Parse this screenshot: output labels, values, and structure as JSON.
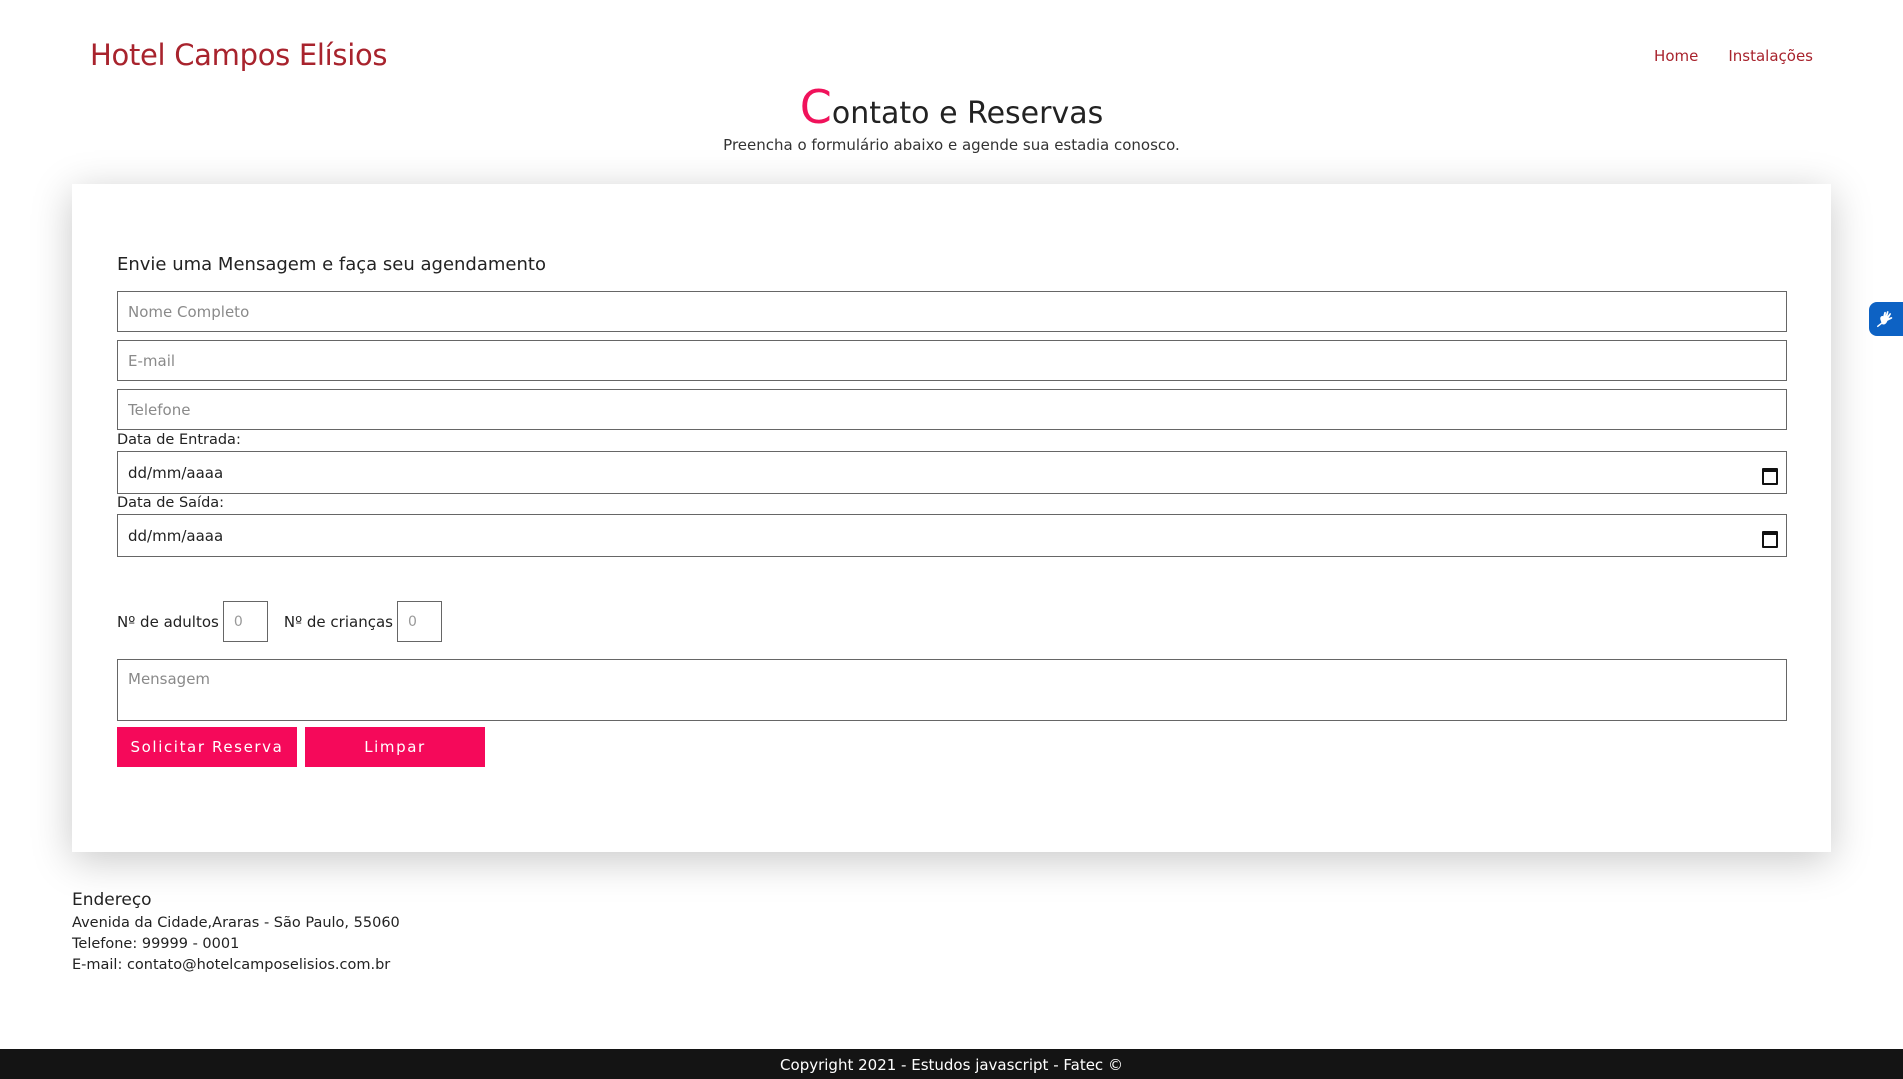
{
  "header": {
    "brand": "Hotel Campos Elísios",
    "nav": [
      {
        "label": "Home"
      },
      {
        "label": "Instalações"
      }
    ]
  },
  "page": {
    "title_initial": "C",
    "title_rest": "ontato e Reservas",
    "subtitle": "Preencha o formulário abaixo e agende sua estadia conosco."
  },
  "form": {
    "heading": "Envie uma Mensagem e faça seu agendamento",
    "name_placeholder": "Nome Completo",
    "email_placeholder": "E-mail",
    "phone_placeholder": "Telefone",
    "checkin_label": "Data de Entrada:",
    "checkin_value": "dd/mm/aaaa",
    "checkout_label": "Data de Saída:",
    "checkout_value": "dd/mm/aaaa",
    "adults_label": "Nº de adultos",
    "adults_placeholder": "0",
    "children_label": "Nº de crianças",
    "children_placeholder": "0",
    "message_placeholder": "Mensagem",
    "submit_label": "Solicitar Reserva",
    "clear_label": "Limpar"
  },
  "address": {
    "title": "Endereço",
    "line1": "Avenida da Cidade,Araras - São Paulo, 55060",
    "phone": "Telefone: 99999 - 0001",
    "email": "E-mail: contato@hotelcamposelisios.com.br"
  },
  "footer": {
    "text": "Copyright 2021 - Estudos javascript - Fatec ©"
  },
  "accessibility": {
    "icon": "sign-language-icon"
  },
  "colors": {
    "brand": "#a8232d",
    "accent": "#f5095a",
    "footer_bg": "#141414",
    "accessibility_bg": "#0d62c4"
  }
}
